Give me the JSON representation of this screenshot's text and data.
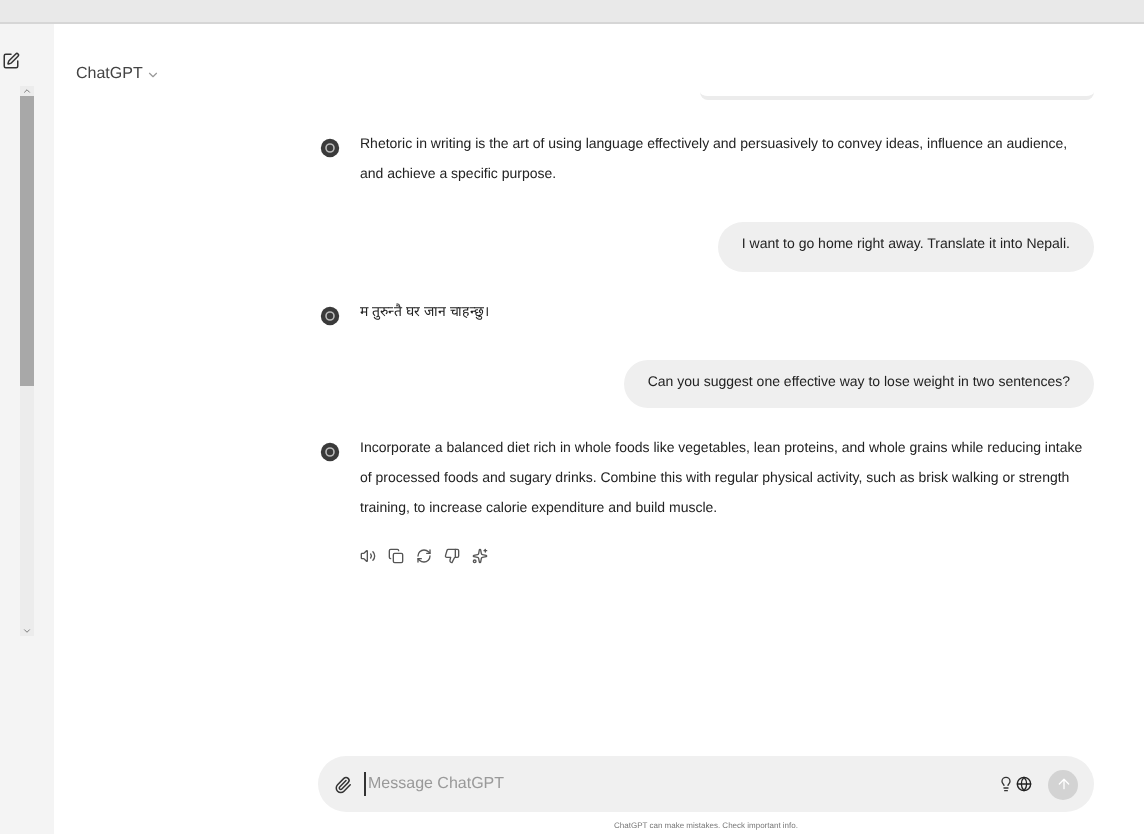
{
  "header": {
    "title": "ChatGPT"
  },
  "messages": [
    {
      "kind": "assistant",
      "text": "Rhetoric in writing is the art of using language effectively and persuasively to convey ideas, influence an audience, and achieve a specific purpose."
    },
    {
      "kind": "user",
      "text": "I want to go home right away. Translate it into Nepali."
    },
    {
      "kind": "assistant",
      "text": "म तुरुन्तै घर जान चाहन्छु।"
    },
    {
      "kind": "user",
      "text": "Can you suggest one effective way to lose weight in two sentences?"
    },
    {
      "kind": "assistant",
      "text": "Incorporate a balanced diet rich in whole foods like vegetables, lean proteins, and whole grains while reducing intake of processed foods and sugary drinks. Combine this with regular physical activity, such as brisk walking or strength training, to increase calorie expenditure and build muscle.",
      "actions": true
    }
  ],
  "composer": {
    "placeholder": "Message ChatGPT"
  },
  "footer": "ChatGPT can make mistakes. Check important info."
}
